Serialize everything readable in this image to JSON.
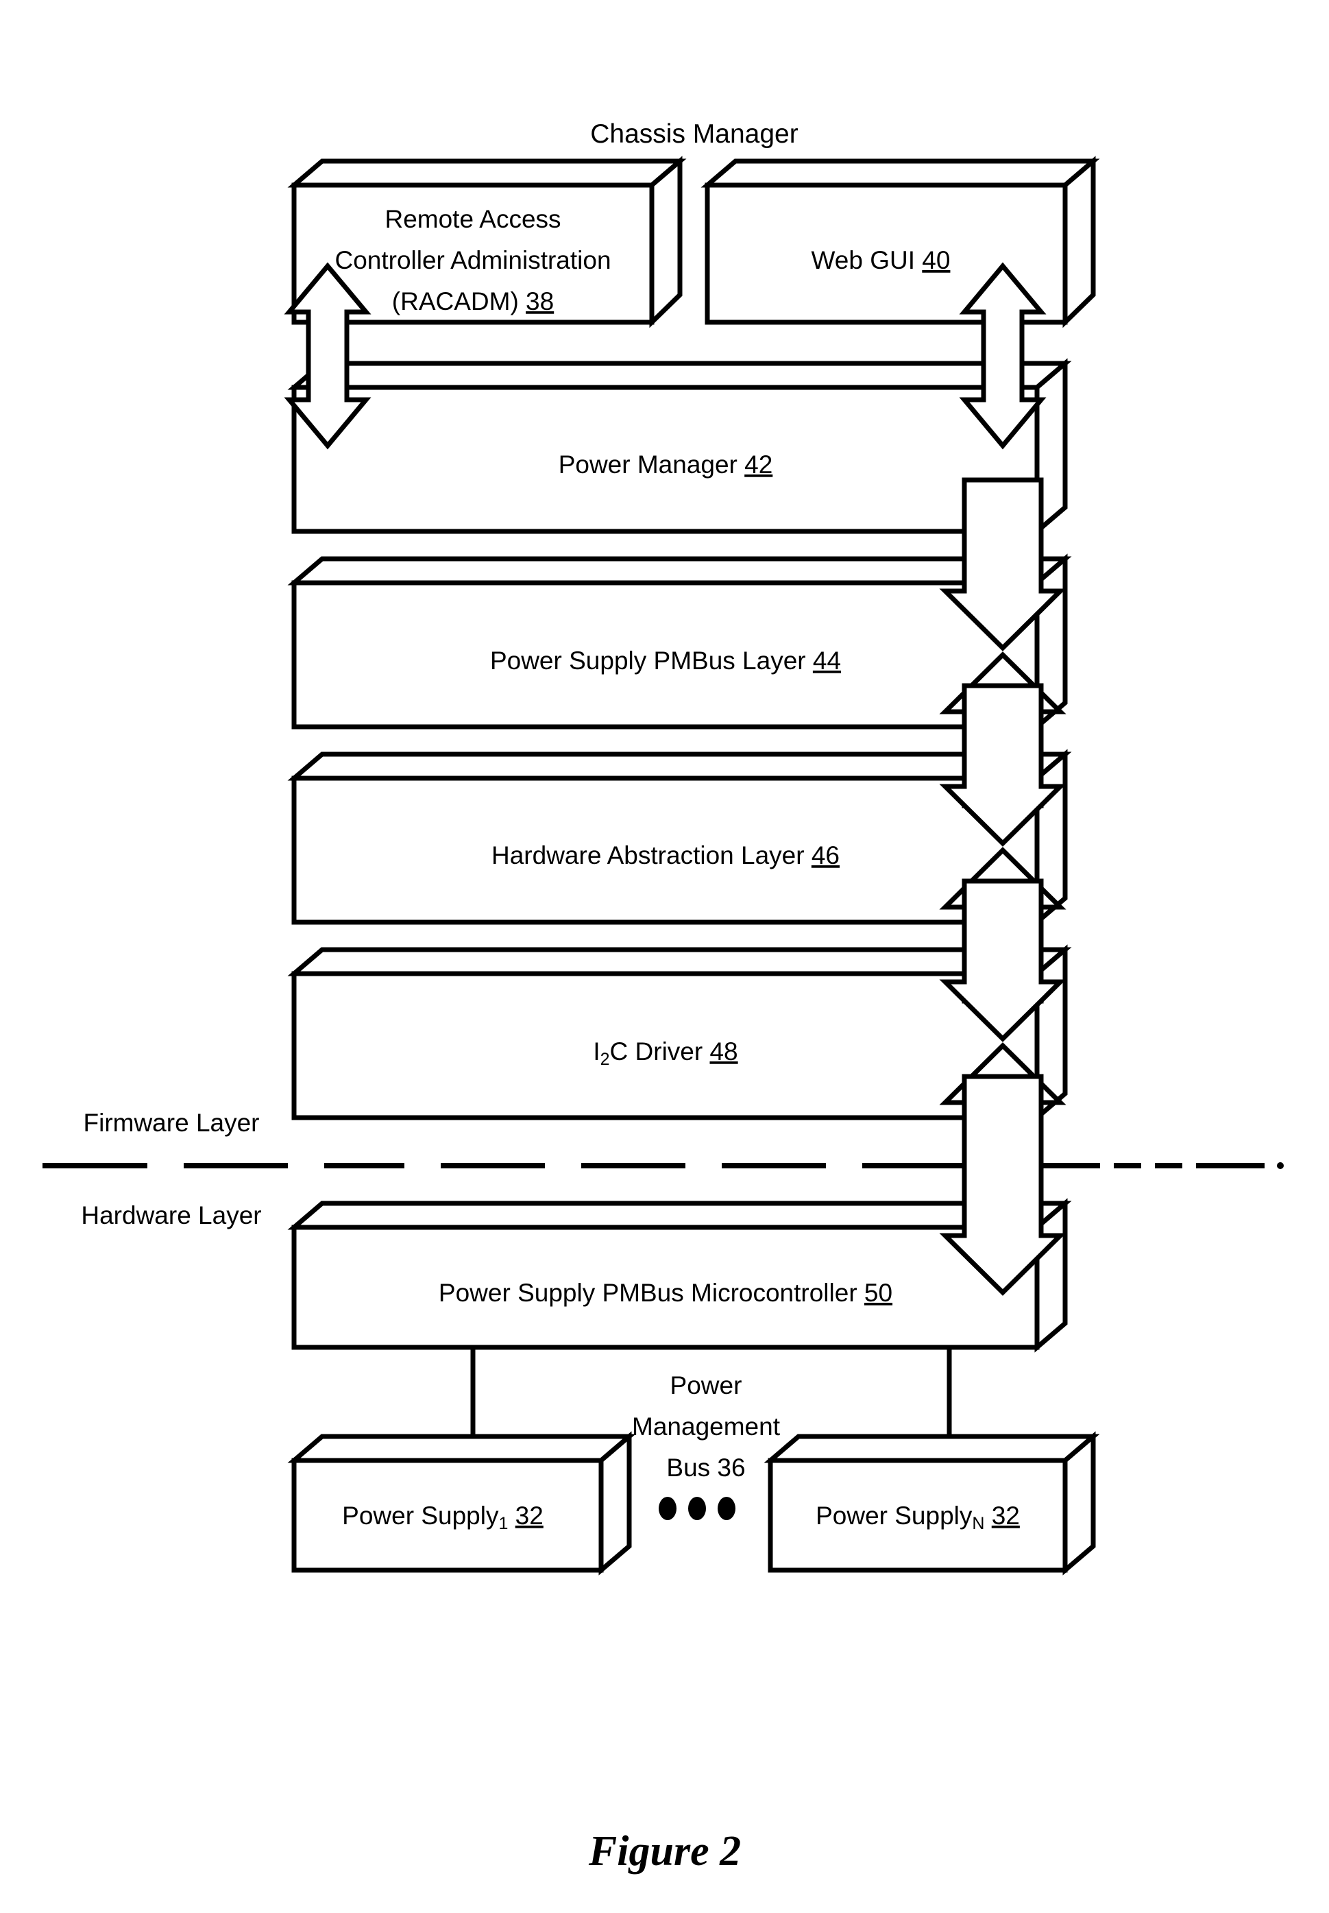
{
  "figure": {
    "caption": "Figure 2",
    "title": "Chassis Manager"
  },
  "layer_labels": {
    "firmware": "Firmware Layer",
    "hardware": "Hardware Layer"
  },
  "blocks": [
    {
      "id": "racadm",
      "lines": [
        "Remote Access",
        "Controller Administration",
        "(RACADM) "
      ],
      "ref": "38",
      "label_plain": "Remote Access Controller Administration (RACADM) 38"
    },
    {
      "id": "web-gui",
      "lines": [
        "Web GUI "
      ],
      "ref": "40",
      "label_plain": "Web GUI 40"
    },
    {
      "id": "power-manager",
      "lines": [
        "Power Manager "
      ],
      "ref": "42",
      "label_plain": "Power Manager 42"
    },
    {
      "id": "pmbus-layer",
      "lines": [
        "Power Supply PMBus Layer "
      ],
      "ref": "44",
      "label_plain": "Power Supply PMBus Layer 44"
    },
    {
      "id": "hal",
      "lines": [
        "Hardware Abstraction Layer "
      ],
      "ref": "46",
      "label_plain": "Hardware Abstraction Layer 46"
    },
    {
      "id": "i2c-driver",
      "lines": [
        "I",
        "2",
        "C Driver "
      ],
      "ref": "48",
      "label_plain": "I2C Driver 48"
    },
    {
      "id": "pmbus-microcontroller",
      "lines": [
        "Power Supply PMBus Microcontroller "
      ],
      "ref": "50",
      "label_plain": "Power Supply PMBus Microcontroller 50"
    },
    {
      "id": "power-supply-1",
      "lines": [
        "Power Supply",
        "1",
        " "
      ],
      "ref": "32",
      "label_plain": "Power Supply1 32"
    },
    {
      "id": "power-supply-n",
      "lines": [
        "Power Supply",
        "N",
        " "
      ],
      "ref": "32",
      "label_plain": "Power SupplyN 32"
    }
  ],
  "text_nodes": {
    "i2c_prefix": "I",
    "i2c_subscript": "2",
    "i2c_suffix": "C Driver ",
    "i2c_ref": "48",
    "ps1_prefix": "Power Supply",
    "ps1_subscript": "1",
    "ps1_ref": "32",
    "psn_prefix": "Power Supply",
    "psn_subscript": "N",
    "psn_ref": "32",
    "racadm_line1": "Remote Access",
    "racadm_line2": "Controller Administration",
    "racadm_line3": "(RACADM) ",
    "racadm_ref": "38",
    "webgui_text": "Web GUI ",
    "webgui_ref": "40",
    "power_manager_text": "Power Manager ",
    "power_manager_ref": "42",
    "pmbus_layer_text": "Power Supply PMBus Layer ",
    "pmbus_layer_ref": "44",
    "hal_text": "Hardware Abstraction Layer ",
    "hal_ref": "46",
    "micro_text": "Power Supply PMBus Microcontroller ",
    "micro_ref": "50"
  },
  "bus": {
    "line1": "Power",
    "line2": "Management",
    "line3": "Bus 36",
    "label_plain": "Power Management Bus 36"
  },
  "colors": {
    "stroke": "#000000",
    "fill": "#ffffff",
    "text": "#000000"
  }
}
